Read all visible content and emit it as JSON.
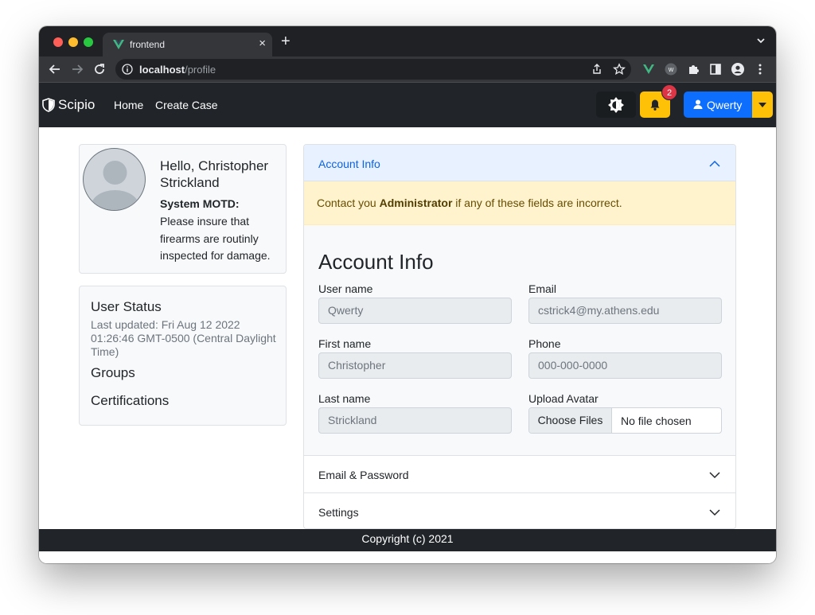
{
  "browser": {
    "tab_title": "frontend",
    "tab_close": "×",
    "new_tab": "+",
    "url_host": "localhost",
    "url_path": "/profile"
  },
  "navbar": {
    "brand": "Scipio",
    "links": [
      "Home",
      "Create Case"
    ],
    "notification_count": "2",
    "user_name": "Qwerty"
  },
  "profile": {
    "greeting": "Hello, Christopher Strickland",
    "motd_label": "System MOTD:",
    "motd_text": "Please insure that firearms are routinly inspected for damage."
  },
  "status": {
    "title": "User Status",
    "last_updated": "Last updated: Fri Aug 12 2022 01:26:46 GMT-0500 (Central Daylight Time)",
    "groups": "Groups",
    "certifications": "Certifications"
  },
  "accordion": {
    "account_header": "Account Info",
    "alert_prefix": "Contact you ",
    "alert_bold": "Administrator",
    "alert_suffix": " if any of these fields are incorrect.",
    "form_title": "Account Info",
    "fields": {
      "username_label": "User name",
      "username_value": "Qwerty",
      "email_label": "Email",
      "email_value": "cstrick4@my.athens.edu",
      "firstname_label": "First name",
      "firstname_value": "Christopher",
      "phone_label": "Phone",
      "phone_placeholder": "000-000-0000",
      "lastname_label": "Last name",
      "lastname_value": "Strickland",
      "avatar_label": "Upload Avatar",
      "avatar_button": "Choose Files",
      "avatar_status": "No file chosen"
    },
    "email_password_header": "Email & Password",
    "settings_header": "Settings"
  },
  "footer": {
    "text": "Copyright (c) 2021"
  },
  "colors": {
    "primary": "#0d6efd",
    "warning": "#ffc107",
    "danger": "#dc3545",
    "dark": "#212529"
  }
}
